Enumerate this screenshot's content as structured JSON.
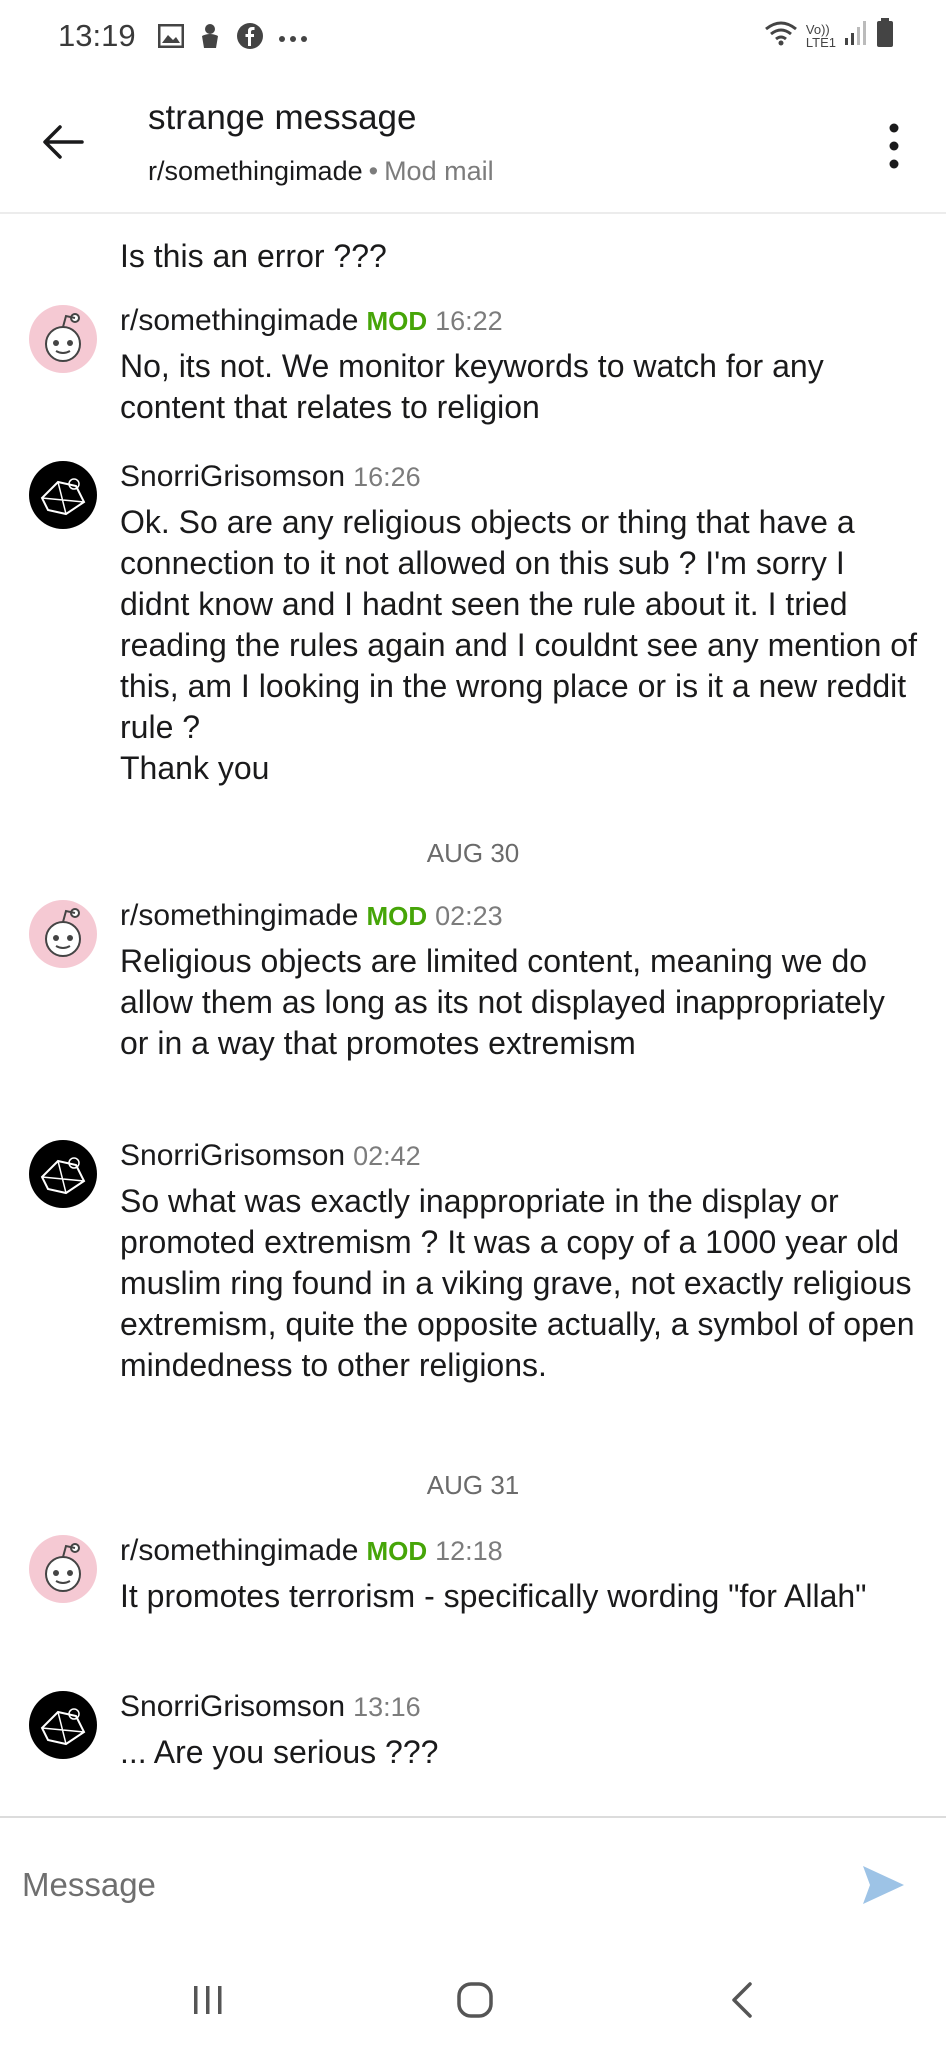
{
  "status_bar": {
    "time": "13:19",
    "left_icons": [
      "gallery-icon",
      "android-icon",
      "facebook-icon",
      "more-notifications-icon"
    ],
    "network_label_top": "Vo))",
    "network_label_bottom": "LTE1",
    "right_icons": [
      "wifi-icon",
      "signal-icon",
      "battery-icon"
    ]
  },
  "header": {
    "title": "strange message",
    "subreddit": "r/somethingimade",
    "separator": "•",
    "channel": "Mod mail"
  },
  "conversation": {
    "preview_text": "Is this an error ???",
    "mod_badge": "MOD",
    "colors": {
      "mod_badge": "#46a508",
      "send_icon": "#9dc3e6",
      "avatar_mod": "#f5c9d3"
    },
    "messages": [
      {
        "author": "r/somethingimade",
        "is_mod": true,
        "time": "16:22",
        "body": "No, its not. We monitor keywords to watch for any content that relates to religion"
      },
      {
        "author": "SnorriGrisomson",
        "is_mod": false,
        "time": "16:26",
        "body": "Ok. So are any religious objects or thing that have a connection to it not allowed on this sub ? I'm sorry I didnt know and I hadnt seen the rule about it. I tried reading the rules again and I couldnt see any mention of this, am I looking in the wrong place or is it a new reddit rule ?\nThank you"
      },
      {
        "date_separator": "AUG 30"
      },
      {
        "author": "r/somethingimade",
        "is_mod": true,
        "time": "02:23",
        "body": "Religious objects are limited content, meaning we do allow them as long as its not displayed inappropriately or in a way that promotes extremism"
      },
      {
        "author": "SnorriGrisomson",
        "is_mod": false,
        "time": "02:42",
        "body": "So what was exactly inappropriate in the display or promoted extremism ? It was a copy of a 1000 year old muslim ring found in a viking grave, not exactly religious extremism, quite the opposite actually, a symbol of open mindedness to other religions."
      },
      {
        "date_separator": "AUG 31"
      },
      {
        "author": "r/somethingimade",
        "is_mod": true,
        "time": "12:18",
        "body": "It promotes terrorism - specifically wording \"for Allah\""
      },
      {
        "author": "SnorriGrisomson",
        "is_mod": false,
        "time": "13:16",
        "body": "... Are you serious ???"
      }
    ]
  },
  "composer": {
    "placeholder": "Message",
    "value": ""
  },
  "nav_bar": {
    "icons": [
      "recent-apps-icon",
      "home-icon",
      "back-nav-icon"
    ]
  }
}
